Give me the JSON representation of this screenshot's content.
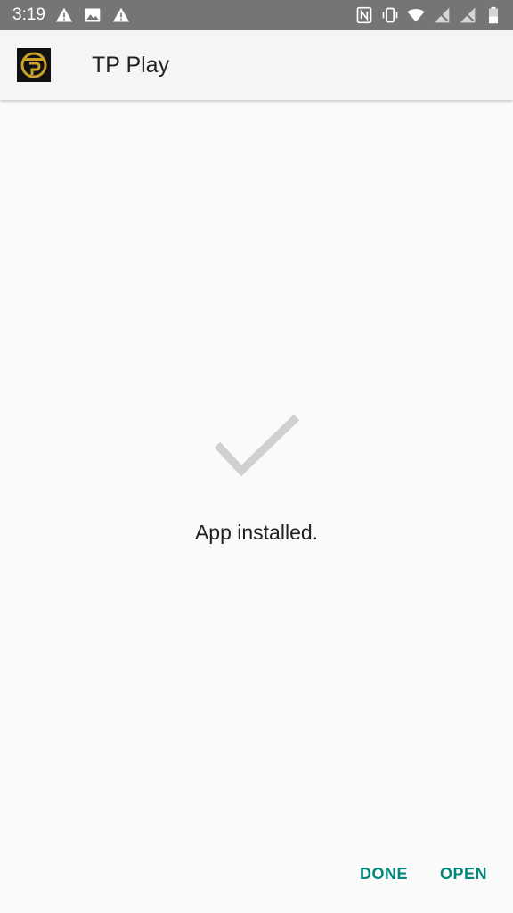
{
  "status_bar": {
    "time": "3:19",
    "left_icons": [
      "warning-icon",
      "image-icon",
      "warning-icon"
    ],
    "right_icons": [
      "nfc-icon",
      "vibrate-icon",
      "wifi-icon",
      "no-signal-icon",
      "no-signal-icon",
      "battery-icon"
    ]
  },
  "app_bar": {
    "title": "TP Play",
    "icon": "tp-play-logo-icon"
  },
  "main": {
    "icon": "check-icon",
    "message": "App installed."
  },
  "actions": {
    "done_label": "DONE",
    "open_label": "OPEN"
  },
  "colors": {
    "status_bar_bg": "#757575",
    "app_bar_bg": "#f5f5f5",
    "background": "#fafafa",
    "accent": "#00897b",
    "check_gray": "#cfd0d2",
    "logo_gold": "#c9a227"
  }
}
